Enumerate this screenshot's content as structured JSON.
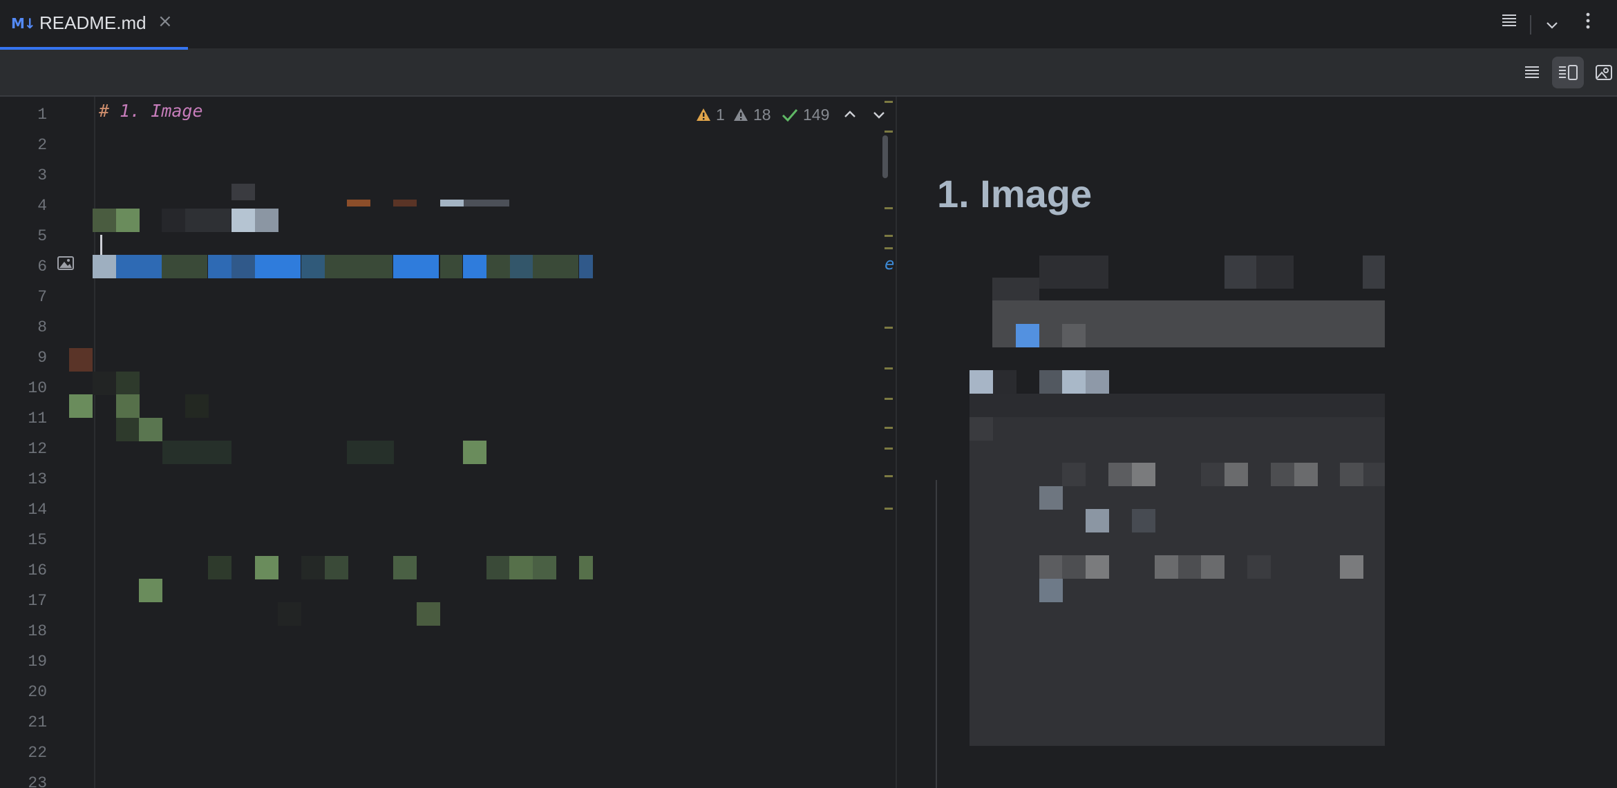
{
  "tab": {
    "icon_text": "M↓",
    "label": "README.md",
    "close": "×"
  },
  "tabbar_icons": [
    "recent-files-icon",
    "chevron-down-icon",
    "more-vertical-icon"
  ],
  "toolbar": {
    "modes": [
      "editor-only-icon",
      "editor-and-preview-icon",
      "preview-only-icon"
    ],
    "active_mode": "editor-and-preview"
  },
  "editor": {
    "line_numbers": [
      "1",
      "2",
      "3",
      "4",
      "5",
      "6",
      "7",
      "8",
      "9",
      "10",
      "11",
      "12",
      "13",
      "14",
      "15",
      "16",
      "17",
      "18",
      "19",
      "20",
      "21",
      "22",
      "23"
    ],
    "heading_hash": "# ",
    "heading_text": "1. Image",
    "inspections": {
      "warnings": "1",
      "weak_warnings": "18",
      "ok": "149"
    },
    "overflow_fragment": "e"
  },
  "preview": {
    "heading": "1. Image"
  },
  "colors": {
    "background": "#1e1f22",
    "panel": "#2b2d30",
    "accent": "#3574f0",
    "line_number": "#6f737a",
    "heading_markup": "#c77dbb",
    "warning": "#e0a44a"
  }
}
